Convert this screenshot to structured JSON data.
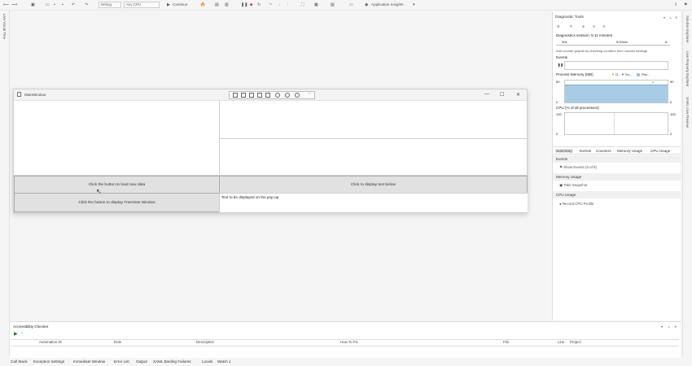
{
  "toolbar": {
    "config_select": "Debug",
    "platform_select": "Any CPU",
    "start_label": "Continue",
    "app_insights_label": "Application Insights"
  },
  "left_strip": {
    "label": "Live Visual Tree"
  },
  "right_strip": {
    "items": [
      "Solution Explorer",
      "Live Property Explorer",
      "XAML Live Preview"
    ]
  },
  "app_window": {
    "title": "MainWindow",
    "button_load": "Click the button to load new data",
    "button_treeview": "Click the button to display TreeView Window",
    "button_display_text": "Click to display text below",
    "popup_text": "Text to be displayed on the pop-up"
  },
  "diagnostic_tools": {
    "title": "Diagnostic Tools",
    "session_label": "Diagnostics session: 5:11 minutes",
    "timeline_start": "30s",
    "timeline_mid": "5:00min",
    "timeline_end": "5:",
    "hint": "Add counter graphs by checking counters from counter settings",
    "events_label": "Events",
    "memory_label": "Process Memory (MB)",
    "memory_legend": [
      "G...",
      "Sn...",
      "Priv..."
    ],
    "memory_ymax_left": "50",
    "memory_ymin_left": "0",
    "memory_ymax_right": "50",
    "memory_ymin_right": "0",
    "cpu_label": "CPU (% of all processors)",
    "cpu_ymax_left": "100",
    "cpu_ymin_left": "0",
    "cpu_ymax_right": "100",
    "cpu_ymin_right": "0",
    "tabs": [
      "Summary",
      "Events",
      "Counters",
      "Memory Usage",
      "CPU Usage"
    ],
    "events_section": "Events",
    "events_item": "Show Events (5 of 5)",
    "memory_section": "Memory Usage",
    "memory_item": "Take Snapshot",
    "cpu_section": "CPU Usage",
    "cpu_item": "Record CPU Profile"
  },
  "bottom_panel": {
    "title": "Accessibility Checker",
    "columns": [
      "Automation ID",
      "Role",
      "Description",
      "How To Fix",
      "File",
      "Line",
      "Project"
    ]
  },
  "status_tabs": [
    "Call Stack",
    "Exception Settings",
    "Immediate Window",
    "Error List",
    "Output",
    "XAML Binding Failures",
    "Locals",
    "Watch 1"
  ]
}
